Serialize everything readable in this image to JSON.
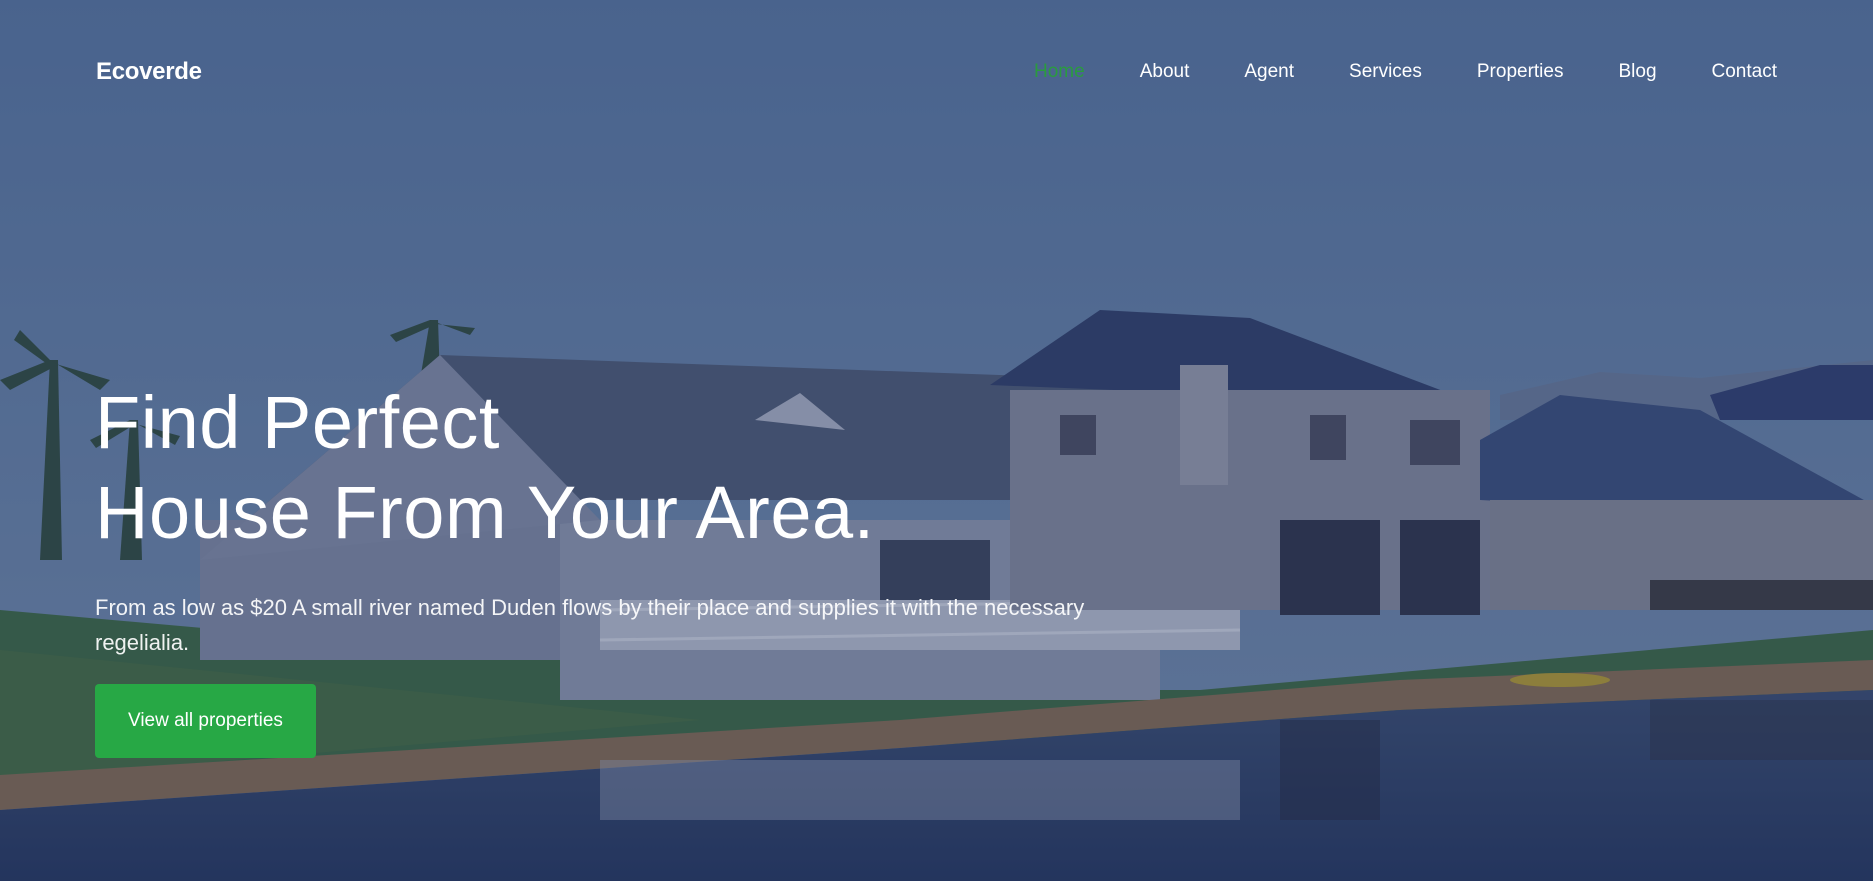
{
  "brand": "Ecoverde",
  "nav": {
    "items": [
      {
        "label": "Home",
        "active": true
      },
      {
        "label": "About",
        "active": false
      },
      {
        "label": "Agent",
        "active": false
      },
      {
        "label": "Services",
        "active": false
      },
      {
        "label": "Properties",
        "active": false
      },
      {
        "label": "Blog",
        "active": false
      },
      {
        "label": "Contact",
        "active": false
      }
    ]
  },
  "hero": {
    "title_line1": "Find Perfect",
    "title_line2": "House From Your Area.",
    "subtitle": "From as low as $20 A small river named Duden flows by their place and supplies it with the necessary regelialia.",
    "cta_label": "View all properties"
  },
  "colors": {
    "accent": "#27a845",
    "active_nav": "#2a9b3f",
    "overlay": "#283a64"
  }
}
